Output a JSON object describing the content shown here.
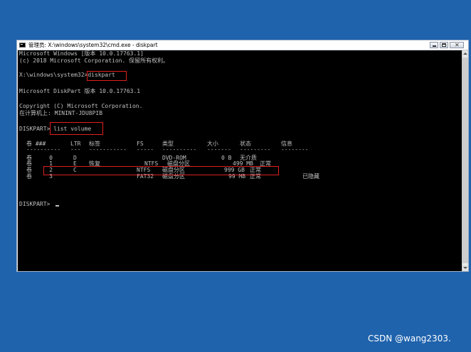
{
  "window": {
    "title": "管理员: X:\\windows\\system32\\cmd.exe - diskpart"
  },
  "console": {
    "lines": [
      "Microsoft Windows [版本 10.0.17763.1]",
      "(c) 2018 Microsoft Corporation. 保留所有权利。",
      "X:\\windows\\system32>diskpart",
      "Microsoft DiskPart 版本 10.0.17763.1",
      "Copyright (C) Microsoft Corporation.",
      "在计算机上: MININT-JDU8PIB",
      "DISKPART> list volume",
      "DISKPART> "
    ],
    "table": {
      "headers": [
        "卷 ###",
        "LTR",
        "标签",
        "FS",
        "类型",
        "大小",
        "状态",
        "信息"
      ],
      "separators": [
        "----------",
        "---",
        "-----------",
        "-----",
        "----------",
        "-------",
        "---------",
        "--------"
      ],
      "rows": [
        [
          "卷     0",
          "D",
          "",
          "",
          "DVD-ROM",
          "0 B",
          "无介质",
          ""
        ],
        [
          "卷     1",
          "E",
          "恢复",
          "NTFS",
          "磁盘分区",
          "499 MB",
          "正常",
          ""
        ],
        [
          "卷     2",
          "C",
          "",
          "NTFS",
          "磁盘分区",
          "999 GB",
          "正常",
          ""
        ],
        [
          "卷     3",
          "",
          "",
          "FAT32",
          "磁盘分区",
          "99 MB",
          "正常",
          "已隐藏"
        ]
      ]
    }
  },
  "colors": {
    "desktop": "#1f63ad",
    "console_bg": "#000000",
    "console_text": "#c0c0c0",
    "highlight": "#e02020"
  },
  "watermark": "CSDN @wang2303."
}
